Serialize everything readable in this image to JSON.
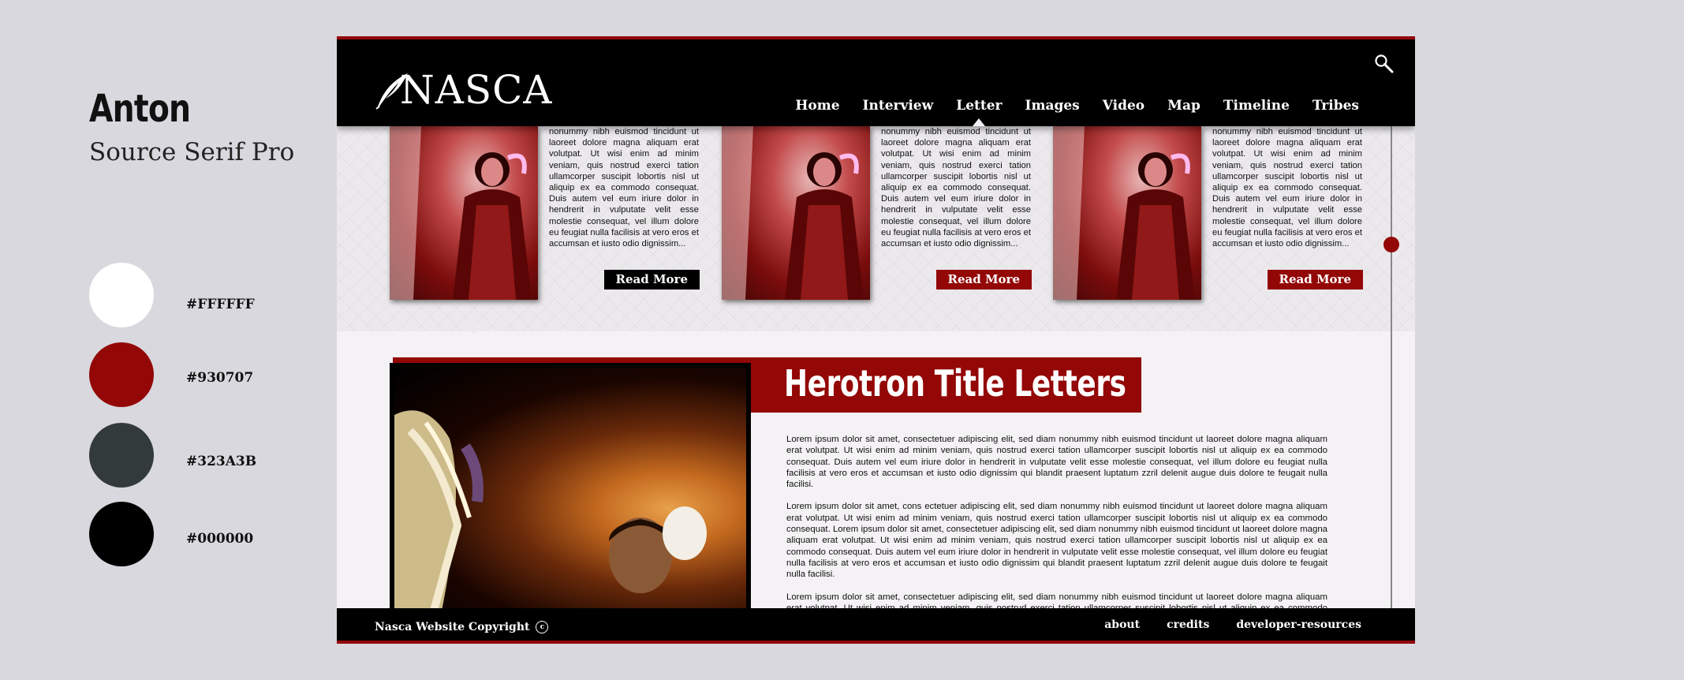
{
  "style_guide": {
    "font_primary": "Anton",
    "font_secondary": "Source Serif Pro",
    "swatches": [
      {
        "hex": "#FFFFFF",
        "label": "#FFFFFF"
      },
      {
        "hex": "#930707",
        "label": "#930707"
      },
      {
        "hex": "#323A3B",
        "label": "#323A3B"
      },
      {
        "hex": "#000000",
        "label": "#000000"
      }
    ]
  },
  "header": {
    "logo_text": "NASCA",
    "nav": [
      "Home",
      "Interview",
      "Letter",
      "Images",
      "Video",
      "Map",
      "Timeline",
      "Tribes"
    ],
    "active_nav": "Letter"
  },
  "cards": [
    {
      "text": "nonummy nibh euismod tincidunt ut laoreet dolore magna aliquam erat volutpat. Ut wisi enim ad minim veniam, quis nostrud exerci tation ullamcorper suscipit lobortis nisl ut aliquip ex ea commodo consequat. Duis autem vel eum iriure dolor in hendrerit in vulputate velit esse molestie consequat, vel illum dolore eu feugiat nulla facilisis at vero eros et accumsan et iusto odio dignissim...",
      "button": "Read More",
      "button_color": "#000000"
    },
    {
      "text": "nonummy nibh euismod tincidunt ut laoreet dolore magna aliquam erat volutpat. Ut wisi enim ad minim veniam, quis nostrud exerci tation ullamcorper suscipit lobortis nisl ut aliquip ex ea commodo consequat. Duis autem vel eum iriure dolor in hendrerit in vulputate velit esse molestie consequat, vel illum dolore eu feugiat nulla facilisis at vero eros et accumsan et iusto odio dignissim...",
      "button": "Read More",
      "button_color": "#930707"
    },
    {
      "text": "nonummy nibh euismod tincidunt ut laoreet dolore magna aliquam erat volutpat. Ut wisi enim ad minim veniam, quis nostrud exerci tation ullamcorper suscipit lobortis nisl ut aliquip ex ea commodo consequat. Duis autem vel eum iriure dolor in hendrerit in vulputate velit esse molestie consequat, vel illum dolore eu feugiat nulla facilisis at vero eros et accumsan et iusto odio dignissim...",
      "button": "Read More",
      "button_color": "#930707"
    }
  ],
  "feature": {
    "title": "Herotron Title Letters",
    "paragraphs": [
      "Lorem ipsum dolor sit amet, consectetuer adipiscing elit, sed diam nonummy nibh euismod tincidunt ut laoreet dolore magna aliquam erat volutpat. Ut wisi enim ad minim veniam, quis nostrud exerci tation ullamcorper suscipit lobortis nisl ut aliquip ex ea commodo consequat. Duis autem vel eum iriure dolor in hendrerit in vulputate velit esse molestie consequat, vel illum dolore eu feugiat nulla facilisis at vero eros et accumsan et iusto odio dignissim qui blandit praesent luptatum zzril delenit augue duis dolore te feugait nulla facilisi.",
      "Lorem ipsum dolor sit amet, cons ectetuer adipiscing elit, sed diam nonummy nibh euismod tincidunt ut laoreet dolore magna aliquam erat volutpat. Ut wisi enim ad minim veniam, quis nostrud exerci tation ullamcorper suscipit lobortis nisl ut aliquip ex ea commodo consequat. Lorem ipsum dolor sit amet, consectetuer adipiscing elit, sed diam nonummy nibh euismod tincidunt ut laoreet dolore magna aliquam erat volutpat. Ut wisi enim ad minim veniam, quis nostrud exerci tation ullamcorper suscipit lobortis nisl ut aliquip ex ea commodo consequat. Duis autem vel eum iriure dolor in hendrerit in vulputate velit esse molestie consequat, vel illum dolore eu feugiat nulla facilisis at vero eros et accumsan et iusto odio dignissim qui blandit praesent luptatum zzril delenit augue duis dolore te feugait nulla facilisi.",
      "Lorem ipsum dolor sit amet, consectetuer adipiscing elit, sed diam nonummy nibh euismod tincidunt ut laoreet dolore magna aliquam erat volutpat. Ut wisi enim ad minim veniam, quis nostrud exerci tation ullamcorper suscipit lobortis nisl ut aliquip ex ea commodo consequat. Duis autem vel eum iriure dolor in hendrerit in vulputate velit esse molestie consequat, vel illum dolore eu feugiat nulla facilisis at vero eros"
    ]
  },
  "footer": {
    "copyright": "Nasca Website Copyright",
    "copyright_symbol": "c",
    "links": [
      "about",
      "credits",
      "developer-resources"
    ]
  },
  "colors": {
    "accent": "#930707",
    "black": "#000000"
  }
}
